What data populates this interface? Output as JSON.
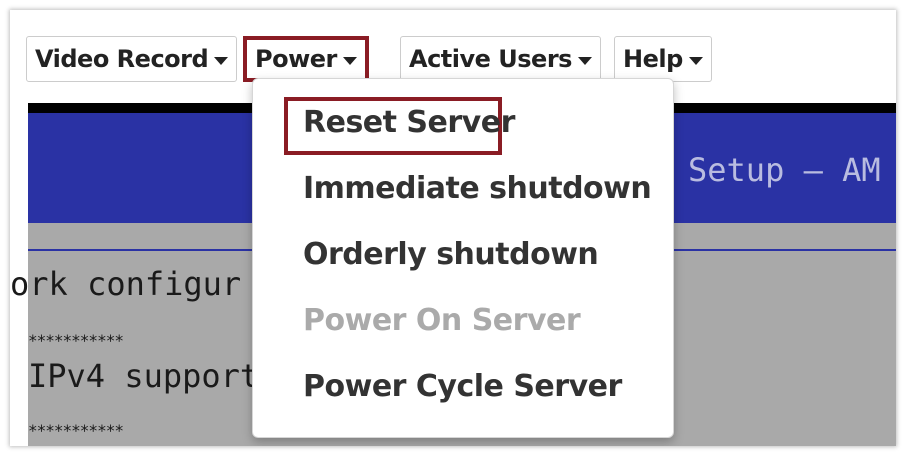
{
  "menubar": {
    "items": [
      {
        "label": "Video Record"
      },
      {
        "label": "Power",
        "active": true
      },
      {
        "label": "Active Users"
      },
      {
        "label": "Help"
      }
    ]
  },
  "console": {
    "title": "Setup – AM",
    "lines": [
      "ork configur",
      "***********",
      "IPv4 support",
      "***********"
    ]
  },
  "power_menu": {
    "items": [
      {
        "label": "Reset Server",
        "highlighted": true,
        "enabled": true
      },
      {
        "label": "Immediate shutdown",
        "enabled": true
      },
      {
        "label": "Orderly shutdown",
        "enabled": true
      },
      {
        "label": "Power On Server",
        "enabled": false
      },
      {
        "label": "Power Cycle Server",
        "enabled": true
      }
    ]
  },
  "colors": {
    "highlight_border": "#8a1c24",
    "console_blue": "#2a32a4",
    "console_gray": "#a9a9a9",
    "disabled_text": "#aaaaaa"
  },
  "icons": {
    "menu_caret": "caret-down-icon"
  }
}
